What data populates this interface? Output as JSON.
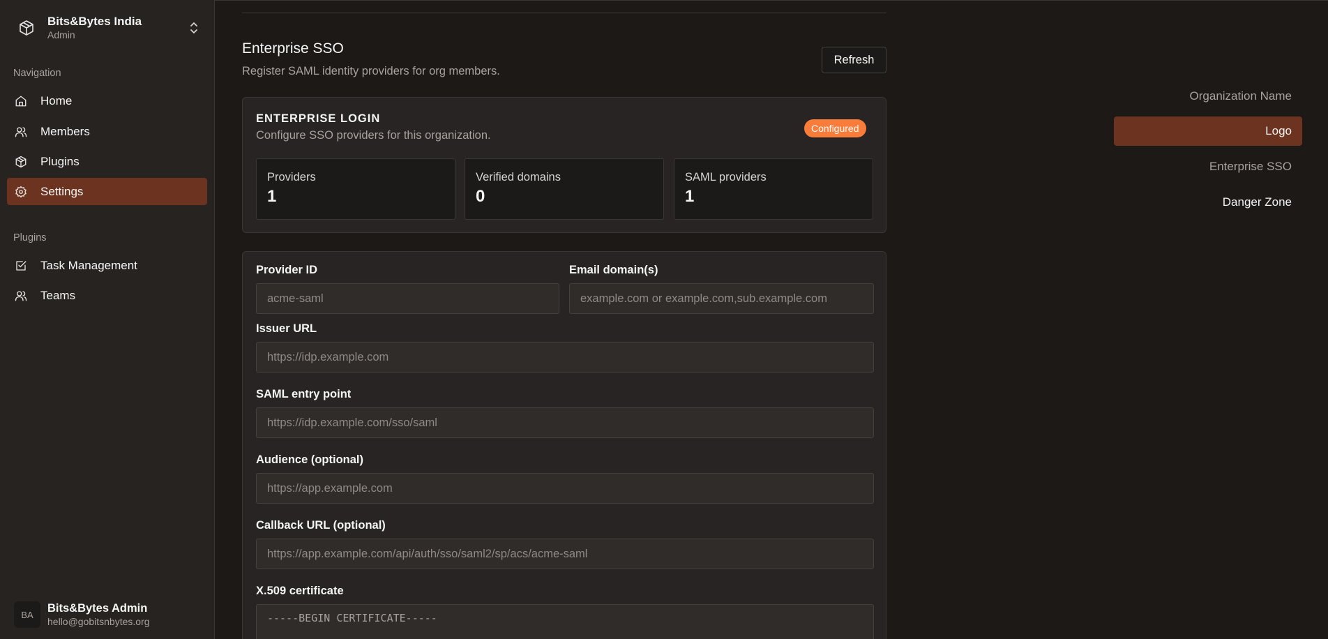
{
  "org": {
    "name": "Bits&Bytes India",
    "role": "Admin",
    "logo_icon": "package-icon",
    "switch_icon": "chevrons-up-down-icon"
  },
  "sidebar": {
    "groups": [
      {
        "label": "Navigation",
        "items": [
          {
            "label": "Home",
            "icon": "home-icon",
            "active": false
          },
          {
            "label": "Members",
            "icon": "users-icon",
            "active": false
          },
          {
            "label": "Plugins",
            "icon": "package-icon",
            "active": false
          },
          {
            "label": "Settings",
            "icon": "gear-icon",
            "active": true
          }
        ]
      },
      {
        "label": "Plugins",
        "items": [
          {
            "label": "Task Management",
            "icon": "checkbox-icon",
            "active": false
          },
          {
            "label": "Teams",
            "icon": "users-icon",
            "active": false
          }
        ]
      }
    ]
  },
  "user": {
    "initials": "BA",
    "name": "Bits&Bytes Admin",
    "email": "hello@gobitsnbytes.org"
  },
  "section": {
    "title": "Enterprise SSO",
    "description": "Register SAML identity providers for org members.",
    "refresh_label": "Refresh"
  },
  "enterprise_card": {
    "title": "ENTERPRISE LOGIN",
    "description": "Configure SSO providers for this organization.",
    "badge": "Configured",
    "stats": [
      {
        "label": "Providers",
        "value": "1"
      },
      {
        "label": "Verified domains",
        "value": "0"
      },
      {
        "label": "SAML providers",
        "value": "1"
      }
    ]
  },
  "form": {
    "provider_id": {
      "label": "Provider ID",
      "value": "",
      "placeholder": "acme-saml"
    },
    "email_domains": {
      "label": "Email domain(s)",
      "value": "",
      "placeholder": "example.com or example.com,sub.example.com"
    },
    "issuer_url": {
      "label": "Issuer URL",
      "value": "",
      "placeholder": "https://idp.example.com"
    },
    "saml_entry_point": {
      "label": "SAML entry point",
      "value": "",
      "placeholder": "https://idp.example.com/sso/saml"
    },
    "audience": {
      "label": "Audience (optional)",
      "value": "",
      "placeholder": "https://app.example.com"
    },
    "callback_url": {
      "label": "Callback URL (optional)",
      "value": "",
      "placeholder": "https://app.example.com/api/auth/sso/saml2/sp/acs/acme-saml"
    },
    "certificate": {
      "label": "X.509 certificate",
      "placeholder": "-----BEGIN CERTIFICATE-----"
    }
  },
  "right_nav": {
    "items": [
      {
        "label": "Organization Name",
        "active": false
      },
      {
        "label": "Logo",
        "active": true
      },
      {
        "label": "Enterprise SSO",
        "active": false
      },
      {
        "label": "Danger Zone",
        "active": false
      }
    ]
  },
  "colors": {
    "accent": "#f97c3a",
    "active_bg": "#6b3320",
    "background": "#1c1917",
    "sidebar_bg": "#262321"
  }
}
